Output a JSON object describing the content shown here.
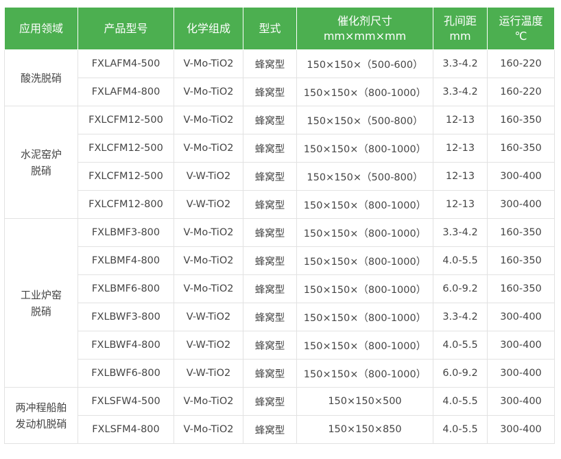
{
  "headers": [
    {
      "lines": [
        "应用领域"
      ]
    },
    {
      "lines": [
        "产品型号"
      ]
    },
    {
      "lines": [
        "化学组成"
      ]
    },
    {
      "lines": [
        "型式"
      ]
    },
    {
      "lines": [
        "催化剂尺寸",
        "mm×mm×mm"
      ]
    },
    {
      "lines": [
        "孔间距",
        "mm"
      ]
    },
    {
      "lines": [
        "运行温度",
        "℃"
      ]
    }
  ],
  "groups": [
    {
      "lines": [
        "酸洗脱硝"
      ],
      "rows": [
        {
          "model": "FXLAFM4-500",
          "composition": "V-Mo-TiO2",
          "type": "蜂窝型",
          "size": "150×150×（500-600）",
          "pitch": "3.3-4.2",
          "temp": "160-220"
        },
        {
          "model": "FXLAFM4-800",
          "composition": "V-Mo-TiO2",
          "type": "蜂窝型",
          "size": "150×150×（800-1000）",
          "pitch": "3.3-4.2",
          "temp": "160-220"
        }
      ]
    },
    {
      "lines": [
        "水泥窑炉",
        "脱硝"
      ],
      "rows": [
        {
          "model": "FXLCFM12-500",
          "composition": "V-Mo-TiO2",
          "type": "蜂窝型",
          "size": "150×150×（500-800）",
          "pitch": "12-13",
          "temp": "160-350"
        },
        {
          "model": "FXLCFM12-500",
          "composition": "V-Mo-TiO2",
          "type": "蜂窝型",
          "size": "150×150×（800-1000）",
          "pitch": "12-13",
          "temp": "160-350"
        },
        {
          "model": "FXLCFM12-500",
          "composition": "V-W-TiO2",
          "type": "蜂窝型",
          "size": "150×150×（500-800）",
          "pitch": "12-13",
          "temp": "300-400"
        },
        {
          "model": "FXLCFM12-800",
          "composition": "V-W-TiO2",
          "type": "蜂窝型",
          "size": "150×150×（800-1000）",
          "pitch": "12-13",
          "temp": "300-400"
        }
      ]
    },
    {
      "lines": [
        "工业炉窑",
        "脱硝"
      ],
      "rows": [
        {
          "model": "FXLBMF3-800",
          "composition": "V-Mo-TiO2",
          "type": "蜂窝型",
          "size": "150×150×（800-1000）",
          "pitch": "3.3-4.2",
          "temp": "160-350"
        },
        {
          "model": "FXLBMF4-800",
          "composition": "V-Mo-TiO2",
          "type": "蜂窝型",
          "size": "150×150×（800-1000）",
          "pitch": "4.0-5.5",
          "temp": "160-350"
        },
        {
          "model": "FXLBMF6-800",
          "composition": "V-Mo-TiO2",
          "type": "蜂窝型",
          "size": "150×150×（800-1000）",
          "pitch": "6.0-9.2",
          "temp": "160-350"
        },
        {
          "model": "FXLBWF3-800",
          "composition": "V-W-TiO2",
          "type": "蜂窝型",
          "size": "150×150×（800-1000）",
          "pitch": "3.3-4.2",
          "temp": "300-400"
        },
        {
          "model": "FXLBWF4-800",
          "composition": "V-W-TiO2",
          "type": "蜂窝型",
          "size": "150×150×（800-1000）",
          "pitch": "4.0-5.5",
          "temp": "300-400"
        },
        {
          "model": "FXLBWF6-800",
          "composition": "V-W-TiO2",
          "type": "蜂窝型",
          "size": "150×150×（800-1000）",
          "pitch": "6.0-9.2",
          "temp": "300-400"
        }
      ]
    },
    {
      "lines": [
        "两冲程船舶",
        "发动机脱硝"
      ],
      "rows": [
        {
          "model": "FXLSFW4-500",
          "composition": "V-Mo-TiO2",
          "type": "蜂窝型",
          "size": "150×150×500",
          "pitch": "4.0-5.5",
          "temp": "300-400"
        },
        {
          "model": "FXLSFM4-800",
          "composition": "V-Mo-TiO2",
          "type": "蜂窝型",
          "size": "150×150×850",
          "pitch": "4.0-5.5",
          "temp": "300-400"
        }
      ]
    }
  ],
  "colors": {
    "header_bg": "#4caf50",
    "header_text": "#ffffff",
    "border": "#e2e2e2",
    "text": "#444444"
  }
}
